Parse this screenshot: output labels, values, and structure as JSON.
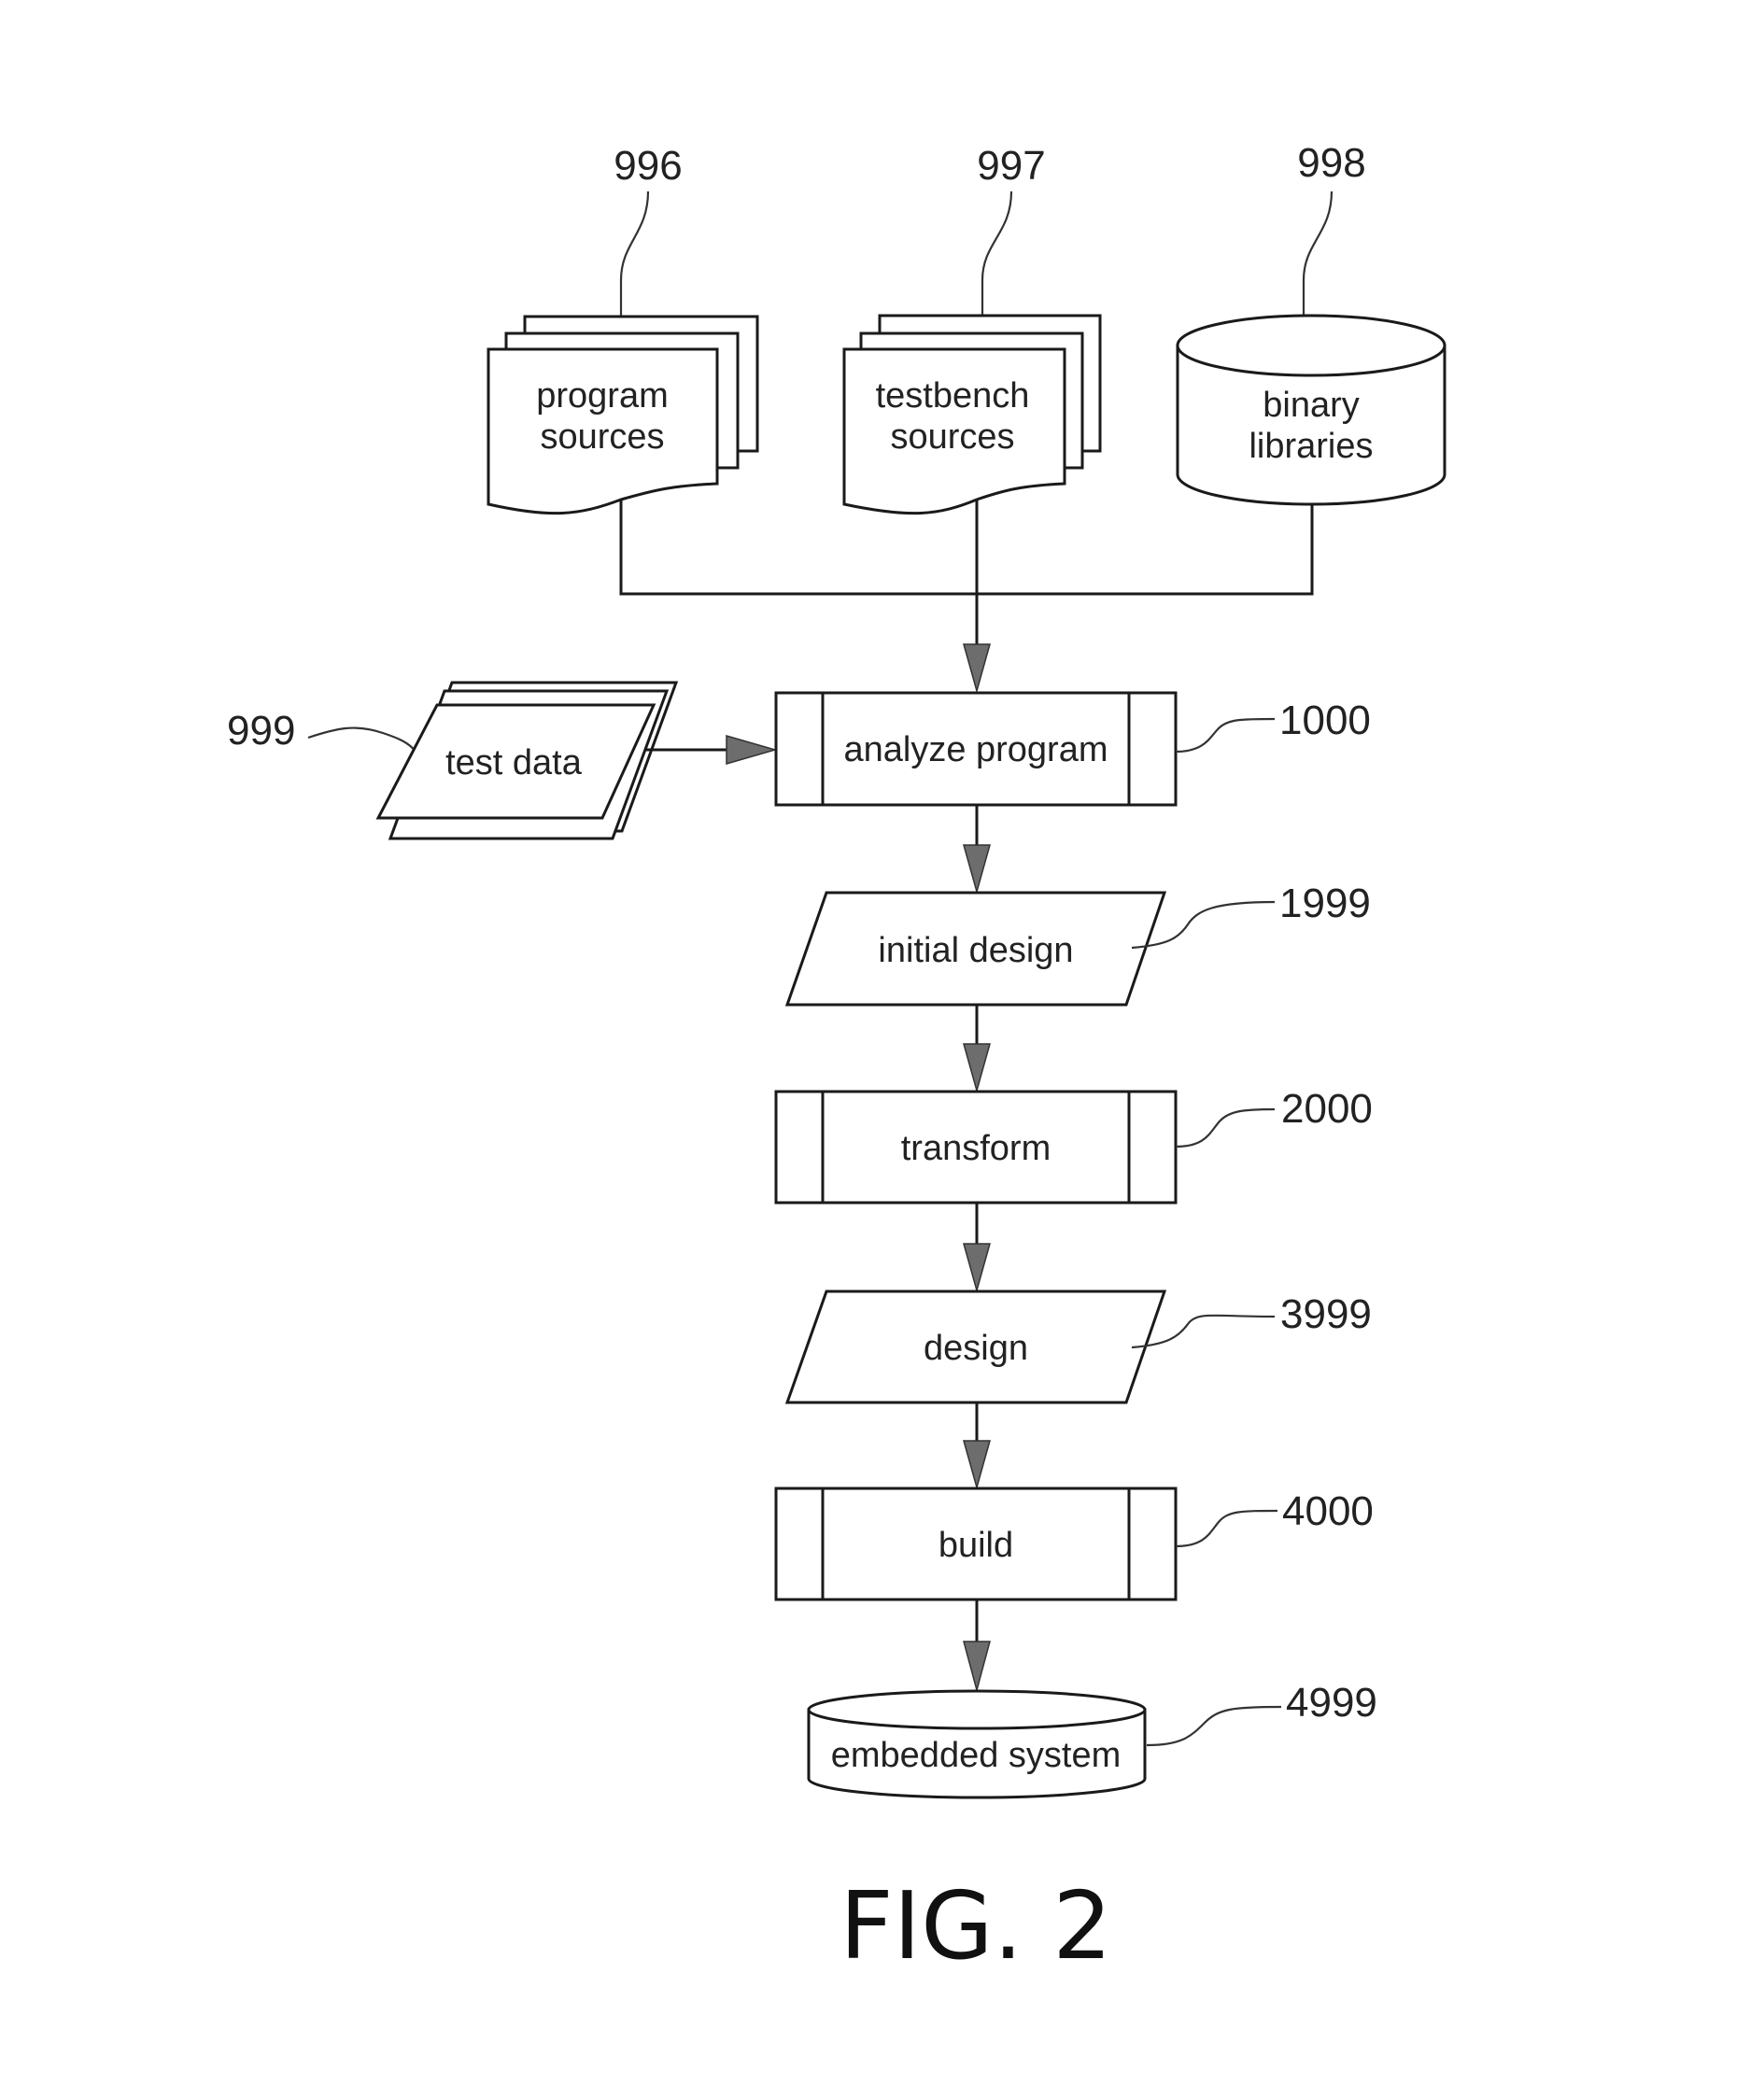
{
  "figure": {
    "caption": "FIG. 2",
    "nodes": {
      "program_sources": {
        "ref": "996",
        "lines": [
          "program",
          "sources"
        ],
        "shape": "multi-document"
      },
      "testbench_sources": {
        "ref": "997",
        "lines": [
          "testbench",
          "sources"
        ],
        "shape": "multi-document"
      },
      "binary_libraries": {
        "ref": "998",
        "lines": [
          "binary",
          "libraries"
        ],
        "shape": "database"
      },
      "test_data": {
        "ref": "999",
        "label": "test data",
        "shape": "multi-data"
      },
      "analyze_program": {
        "ref": "1000",
        "label": "analyze program",
        "shape": "predefined-process"
      },
      "initial_design": {
        "ref": "1999",
        "label": "initial design",
        "shape": "data"
      },
      "transform": {
        "ref": "2000",
        "label": "transform",
        "shape": "predefined-process"
      },
      "design": {
        "ref": "3999",
        "label": "design",
        "shape": "data"
      },
      "build": {
        "ref": "4000",
        "label": "build",
        "shape": "predefined-process"
      },
      "embedded_system": {
        "ref": "4999",
        "label": "embedded system",
        "shape": "database"
      }
    },
    "edges": [
      {
        "from": "program_sources",
        "to": "analyze_program"
      },
      {
        "from": "testbench_sources",
        "to": "analyze_program"
      },
      {
        "from": "binary_libraries",
        "to": "analyze_program"
      },
      {
        "from": "test_data",
        "to": "analyze_program"
      },
      {
        "from": "analyze_program",
        "to": "initial_design"
      },
      {
        "from": "initial_design",
        "to": "transform"
      },
      {
        "from": "transform",
        "to": "design"
      },
      {
        "from": "design",
        "to": "build"
      },
      {
        "from": "build",
        "to": "embedded_system"
      }
    ]
  }
}
